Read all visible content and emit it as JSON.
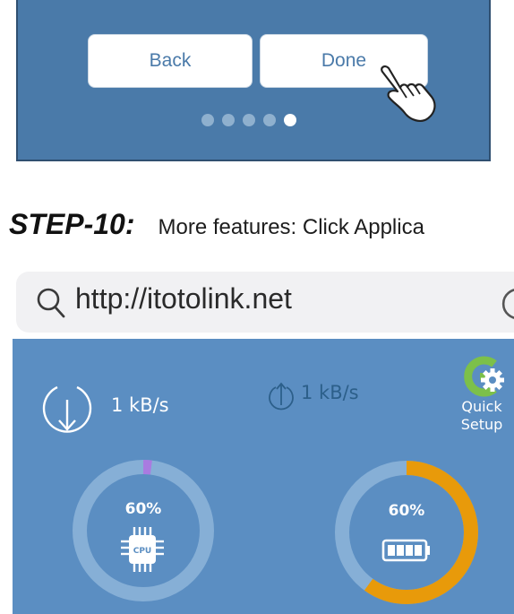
{
  "wizard": {
    "back_label": "Back",
    "done_label": "Done",
    "page_count": 5,
    "current_page": 5,
    "colors": {
      "panel": "#4a7aa9",
      "button_text": "#4a7aa9"
    }
  },
  "step": {
    "title": "STEP-10:",
    "text": "More features: Click Applica"
  },
  "browser": {
    "url": "http://itotolink.net",
    "search_icon": "search-icon",
    "reload_icon": "reload-icon"
  },
  "dashboard": {
    "download_speed": "1 kB/s",
    "upload_speed": "1 kB/s",
    "quick_setup_line1": "Quick",
    "quick_setup_line2": "Setup",
    "cpu": {
      "percent_label": "60%",
      "chip_label": "CPU",
      "fill": 0.02
    },
    "memory": {
      "percent_label": "60%",
      "fill": 0.6
    },
    "colors": {
      "background": "#5b8ec2",
      "memory_arc": "#e89a0a",
      "cpu_arc": "#a97be0",
      "upload_text": "#2c5f8a"
    }
  }
}
